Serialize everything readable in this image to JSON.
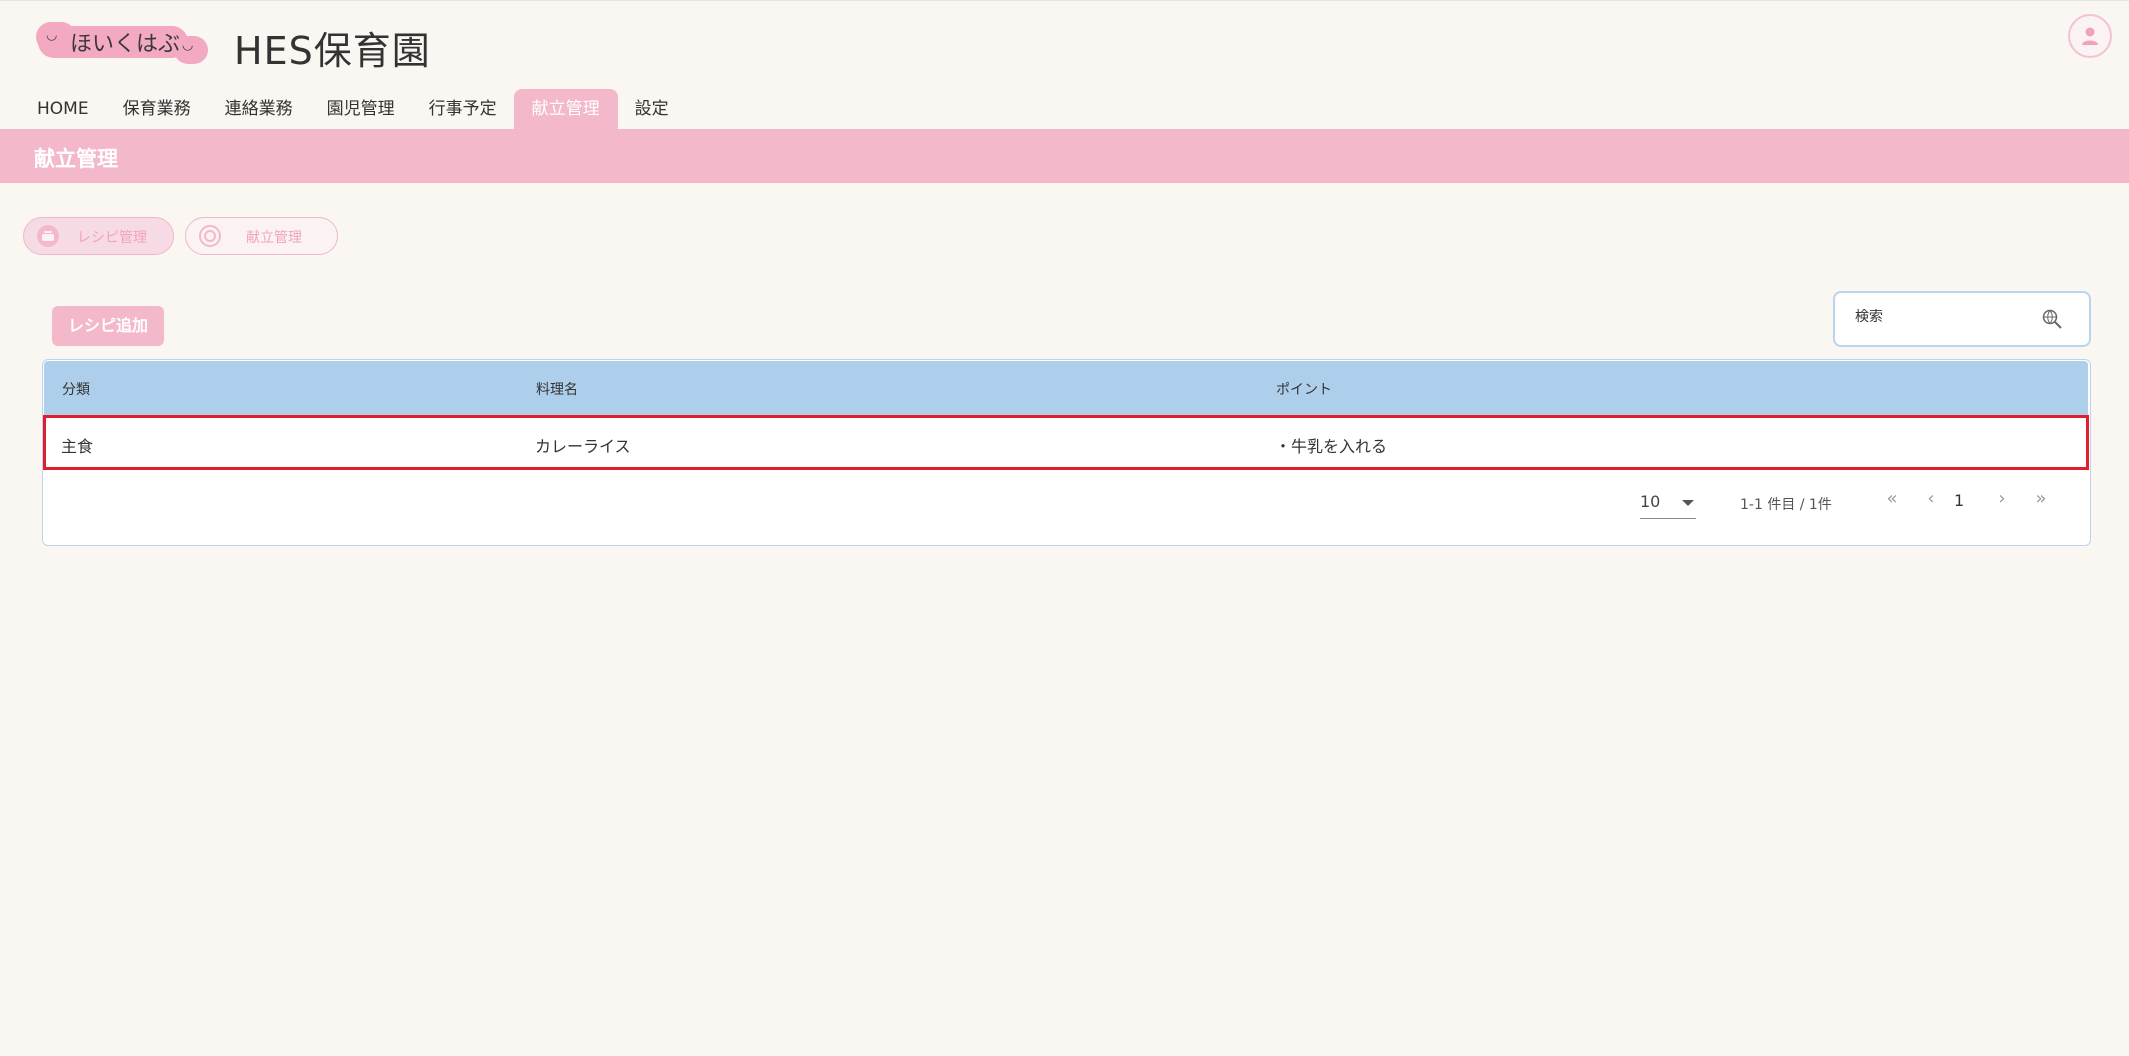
{
  "header": {
    "logo_text": "ほいくはぶ",
    "site_title": "HES保育園"
  },
  "nav": {
    "items": [
      {
        "label": "HOME"
      },
      {
        "label": "保育業務"
      },
      {
        "label": "連絡業務"
      },
      {
        "label": "園児管理"
      },
      {
        "label": "行事予定"
      },
      {
        "label": "献立管理",
        "active": true
      },
      {
        "label": "設定"
      }
    ]
  },
  "page": {
    "title": "献立管理"
  },
  "subtabs": {
    "recipe": "レシピ管理",
    "menu": "献立管理"
  },
  "toolbar": {
    "add_label": "レシピ追加",
    "search_placeholder": "検索"
  },
  "table": {
    "headers": [
      "分類",
      "料理名",
      "ポイント"
    ],
    "rows": [
      {
        "category": "主食",
        "dish": "カレーライス",
        "point": "・牛乳を入れる"
      }
    ]
  },
  "pagination": {
    "per_page": "10",
    "range": "1-1 件目 / 1件",
    "current_page": "1",
    "first": "«",
    "prev": "‹",
    "next": "›",
    "last": "»"
  },
  "colors": {
    "accent_pink": "#f4b8cb",
    "header_blue": "#aecfeb",
    "highlight_red": "#e01e2c",
    "background": "#faf6f1"
  }
}
